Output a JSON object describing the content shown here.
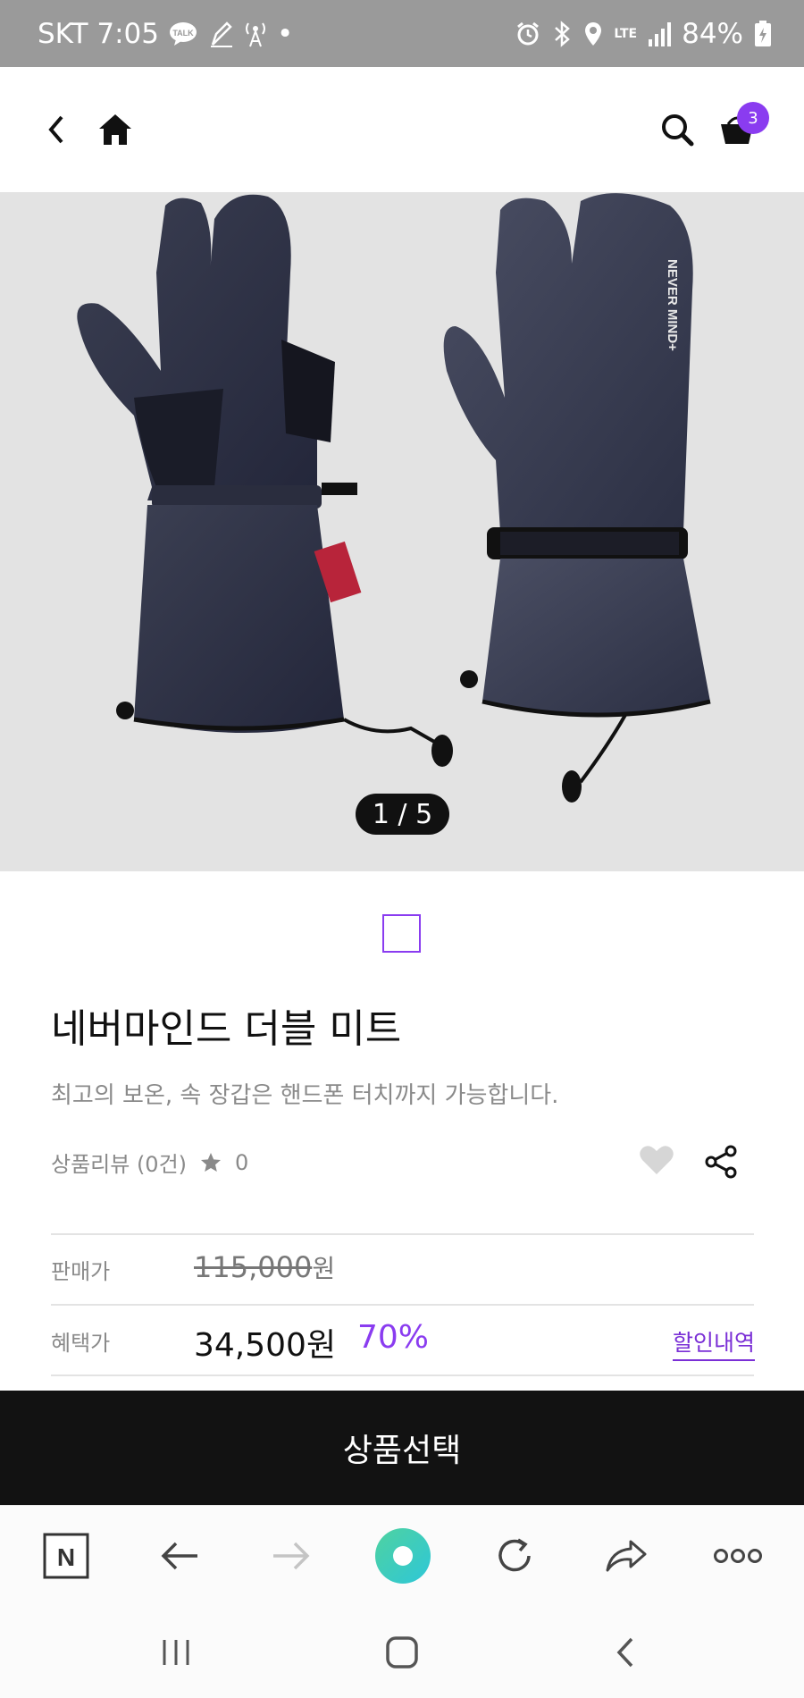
{
  "status_bar": {
    "carrier_time": "SKT 7:05",
    "talk_badge": "TALK",
    "dot": "•",
    "network": "LTE",
    "battery": "84%"
  },
  "header": {
    "cart_count": "3"
  },
  "gallery": {
    "pager": "1 / 5",
    "brand_print": "NEVER MIND+"
  },
  "product": {
    "title": "네버마인드 더블 미트",
    "subtitle": "최고의 보온, 속 장갑은 핸드폰 터치까지 가능합니다.",
    "review_label": "상품리뷰 (0건)",
    "rating": "0"
  },
  "price": {
    "list_label": "판매가",
    "list_price": "115,000",
    "list_unit": "원",
    "benefit_label": "혜택가",
    "sale_price": "34,500원",
    "discount": "70%",
    "discount_link": "할인내역"
  },
  "cta": {
    "select_label": "상품선택"
  },
  "browser": {
    "naver_logo": "N"
  },
  "colors": {
    "accent": "#8a3cf0",
    "cta_bg": "#121212",
    "status_bg": "#9a9a9a"
  },
  "icons": [
    "back-chevron-icon",
    "home-icon",
    "search-icon",
    "cart-icon",
    "star-icon",
    "heart-icon",
    "share-icon",
    "naver-icon",
    "arrow-left-icon",
    "arrow-right-icon",
    "whale-icon",
    "reload-icon",
    "forward-share-icon",
    "more-icon",
    "recents-icon",
    "home-square-icon",
    "nav-back-icon"
  ]
}
